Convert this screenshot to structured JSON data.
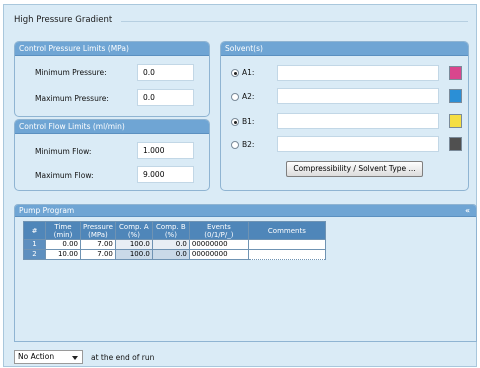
{
  "group_title": "High Pressure Gradient",
  "pressure_limits": {
    "header": "Control Pressure Limits (MPa)",
    "min_label": "Minimum Pressure:",
    "min_value": "0.0",
    "max_label": "Maximum Pressure:",
    "max_value": "0.0"
  },
  "flow_limits": {
    "header": "Control Flow Limits (ml/min)",
    "min_label": "Minimum Flow:",
    "min_value": "1.000",
    "max_label": "Maximum Flow:",
    "max_value": "9.000"
  },
  "solvents": {
    "header": "Solvent(s)",
    "items": [
      {
        "label": "A1:",
        "value": "",
        "selected": true,
        "color": "#d9468d"
      },
      {
        "label": "A2:",
        "value": "",
        "selected": false,
        "color": "#2b8fd6"
      },
      {
        "label": "B1:",
        "value": "",
        "selected": true,
        "color": "#f5de43"
      },
      {
        "label": "B2:",
        "value": "",
        "selected": false,
        "color": "#505050"
      }
    ],
    "button_label": "Compressibility / Solvent Type ..."
  },
  "pump_program": {
    "header": "Pump Program",
    "collapse_glyph": "«",
    "columns": {
      "num": "#",
      "time": [
        "Time",
        "(min)"
      ],
      "pressure": [
        "Pressure",
        "(MPa)"
      ],
      "comp_a": [
        "Comp. A",
        "(%)"
      ],
      "comp_b": [
        "Comp. B",
        "(%)"
      ],
      "events": [
        "Events",
        "(0/1/P/_)"
      ],
      "comments": "Comments"
    },
    "rows": [
      {
        "num": "1",
        "time": "0.00",
        "pressure": "7.00",
        "comp_a": "100.0",
        "comp_b": "0.0",
        "events": "00000000",
        "comments": ""
      },
      {
        "num": "2",
        "time": "10.00",
        "pressure": "7.00",
        "comp_a": "100.0",
        "comp_b": "0.0",
        "events": "00000000",
        "comments": ""
      }
    ]
  },
  "end_action": {
    "selected": "No Action",
    "suffix": "at the end of run"
  }
}
